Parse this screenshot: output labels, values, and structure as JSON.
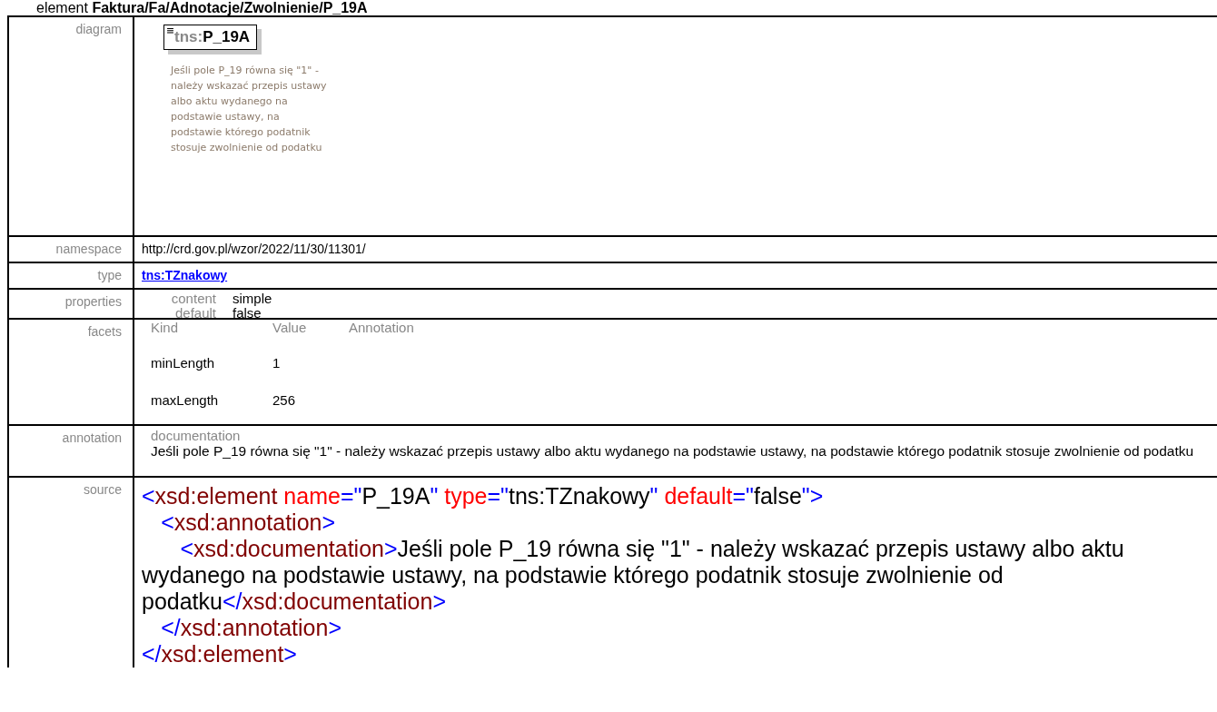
{
  "heading": "element **Faktura/Fa/Adnotacje/Zwolnienie/P_19A**",
  "diagram": {
    "label": "diagram",
    "prefix": "tns:",
    "name": "P_19A",
    "documentation": "Jeśli pole P_19 równa się \"1\" - należy wskazać przepis ustawy albo aktu wydanego na podstawie ustawy, na podstawie którego podatnik stosuje zwolnienie od podatku"
  },
  "namespace": {
    "label": "namespace",
    "value": "http://crd.gov.pl/wzor/2022/11/30/11301/"
  },
  "type": {
    "label": "type",
    "value": "tns:TZnakowy"
  },
  "properties": {
    "label": "properties",
    "items": [
      {
        "name": "content",
        "value": "simple"
      },
      {
        "name": "default",
        "value": "false"
      }
    ]
  },
  "facets": {
    "label": "facets",
    "columns": [
      "Kind",
      "Value",
      "Annotation"
    ],
    "rows": [
      {
        "kind": "minLength",
        "value": "1"
      },
      {
        "kind": "maxLength",
        "value": "256"
      }
    ]
  },
  "annotation": {
    "label": "annotation",
    "heading": "documentation",
    "text": "Jeśli pole P_19 równa się \"1\" - należy wskazać przepis ustawy albo aktu wydanego na podstawie ustawy, na podstawie którego podatnik stosuje zwolnienie od podatku"
  },
  "source": {
    "label": "source",
    "root": {
      "open": [
        {
          "kind": "bracket",
          "text": "<"
        },
        {
          "kind": "tag",
          "text": "xsd:element"
        },
        {
          "kind": "attr",
          "text": " name"
        },
        {
          "kind": "bracket",
          "text": "=\""
        },
        {
          "kind": "text",
          "text": "P_19A"
        },
        {
          "kind": "bracket",
          "text": "\""
        },
        {
          "kind": "attr",
          "text": " type"
        },
        {
          "kind": "bracket",
          "text": "=\""
        },
        {
          "kind": "text",
          "text": "tns:TZnakowy"
        },
        {
          "kind": "bracket",
          "text": "\""
        },
        {
          "kind": "attr",
          "text": " default"
        },
        {
          "kind": "bracket",
          "text": "=\""
        },
        {
          "kind": "text",
          "text": "false"
        },
        {
          "kind": "bracket",
          "text": "\">"
        }
      ],
      "children": [
        {
          "open": [
            {
              "kind": "bracket",
              "text": "<"
            },
            {
              "kind": "tag",
              "text": "xsd:annotation"
            },
            {
              "kind": "bracket",
              "text": ">"
            }
          ],
          "children": [
            {
              "open": [
                {
                  "kind": "bracket",
                  "text": "<"
                },
                {
                  "kind": "tag",
                  "text": "xsd:documentation"
                },
                {
                  "kind": "bracket",
                  "text": ">"
                },
                {
                  "kind": "text",
                  "text": "Jeśli pole P_19 równa się \"1\" - należy wskazać przepis ustawy albo aktu wydanego na podstawie ustawy, na podstawie którego podatnik stosuje zwolnienie od podatku"
                },
                {
                  "kind": "bracket",
                  "text": "</"
                },
                {
                  "kind": "tag",
                  "text": "xsd:documentation"
                },
                {
                  "kind": "bracket",
                  "text": ">"
                }
              ]
            }
          ],
          "close": [
            {
              "kind": "bracket",
              "text": "</"
            },
            {
              "kind": "tag",
              "text": "xsd:annotation"
            },
            {
              "kind": "bracket",
              "text": ">"
            }
          ]
        }
      ],
      "close": [
        {
          "kind": "bracket",
          "text": "</"
        },
        {
          "kind": "tag",
          "text": "xsd:element"
        },
        {
          "kind": "bracket",
          "text": ">"
        }
      ]
    }
  }
}
